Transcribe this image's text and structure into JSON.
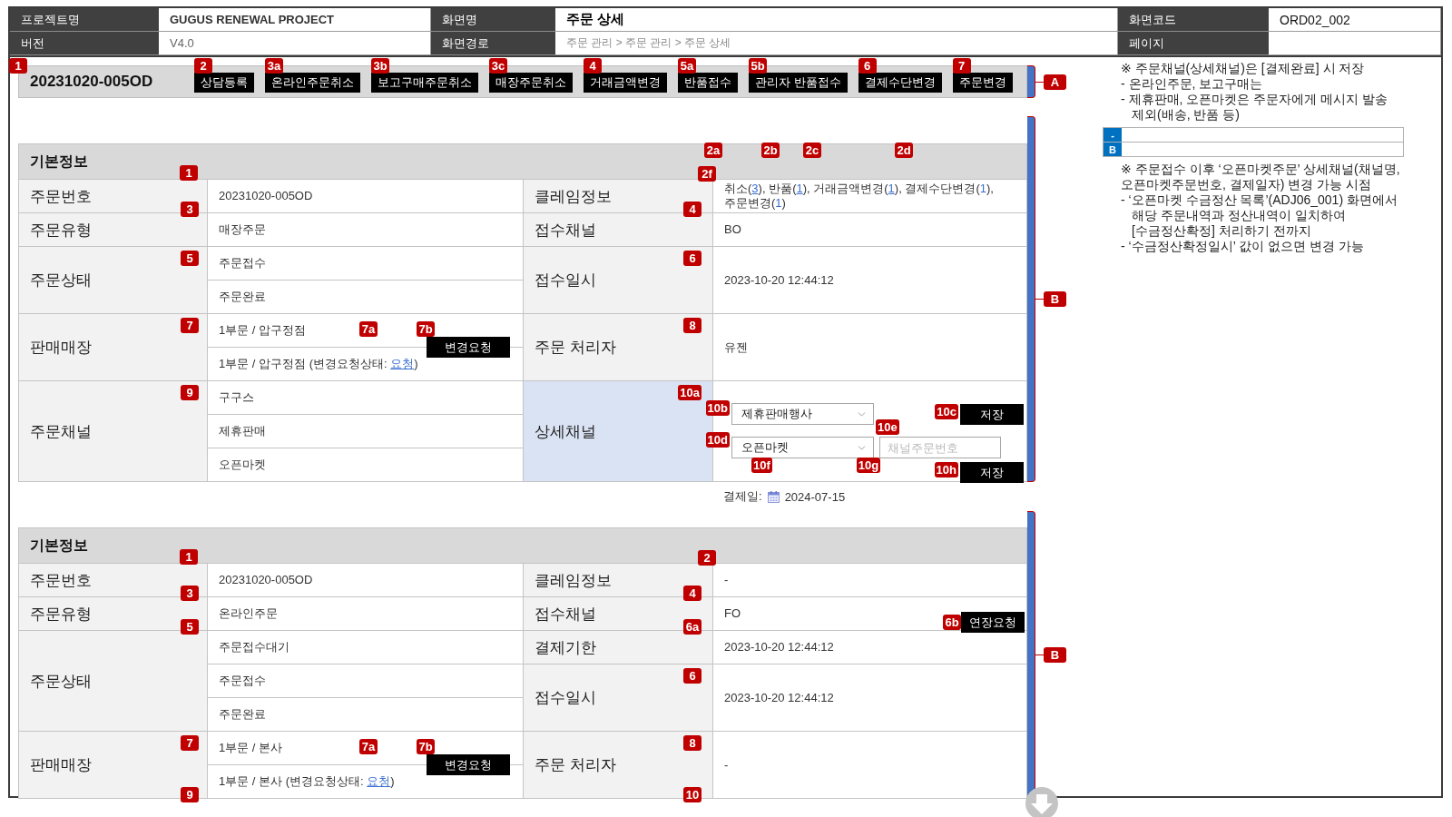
{
  "header": {
    "rows": [
      [
        {
          "label": "프로젝트명",
          "value": "GUGUS RENEWAL PROJECT",
          "kind": "project"
        },
        {
          "label": "화면명",
          "value": "주문 상세",
          "kind": "title"
        },
        {
          "label": "화면코드",
          "value": "ORD02_002",
          "kind": "code"
        }
      ],
      [
        {
          "label": "버전",
          "value": "V4.0",
          "kind": "version"
        },
        {
          "label": "화면경로",
          "value": "주문 관리 > 주문 관리 > 주문 상세",
          "kind": "path"
        },
        {
          "label": "페이지"
        }
      ]
    ]
  },
  "toolbar": {
    "marker": "1",
    "order_number": "20231020-005OD",
    "bracket": "A",
    "buttons": [
      {
        "label": "상담등록",
        "marker": "2"
      },
      {
        "label": "온라인주문취소",
        "marker": "3a"
      },
      {
        "label": "보고구매주문취소",
        "marker": "3b"
      },
      {
        "label": "매장주문취소",
        "marker": "3c"
      },
      {
        "label": "거래금액변경",
        "marker": "4"
      },
      {
        "label": "반품접수",
        "marker": "5a"
      },
      {
        "label": "관리자 반품접수",
        "marker": "5b"
      },
      {
        "label": "결제수단변경",
        "marker": "6"
      },
      {
        "label": "주문변경",
        "marker": "7"
      }
    ]
  },
  "sections": [
    {
      "title": "기본정보",
      "bracket": "B",
      "title_markers": [
        "1"
      ],
      "side_markers": [
        "2a",
        "2b",
        "2c",
        "2d",
        "2f"
      ],
      "rows": [
        {
          "left": {
            "label": "주문번호",
            "markers": [
              "3"
            ],
            "values": [
              {
                "kind": "text",
                "text": "20231020-005OD"
              }
            ]
          },
          "right": [
            {
              "label": "클레임정보",
              "markers": [
                "4"
              ],
              "highlighted": false,
              "value": {
                "kind": "segments",
                "segments": [
                  {
                    "kind": "text",
                    "text": "취소("
                  },
                  {
                    "kind": "link",
                    "text": "3",
                    "underlined": true
                  },
                  {
                    "kind": "text",
                    "text": "), 반품("
                  },
                  {
                    "kind": "link",
                    "text": "1",
                    "underlined": true
                  },
                  {
                    "kind": "text",
                    "text": "), 거래금액변경("
                  },
                  {
                    "kind": "link",
                    "text": "1",
                    "underlined": true
                  },
                  {
                    "kind": "text",
                    "text": "), 결제수단변경("
                  },
                  {
                    "kind": "link",
                    "text": "1",
                    "underlined": false
                  },
                  {
                    "kind": "text",
                    "text": "), 주문변경("
                  },
                  {
                    "kind": "link",
                    "text": "1",
                    "underlined": false
                  },
                  {
                    "kind": "text",
                    "text": ")"
                  }
                ]
              }
            }
          ]
        },
        {
          "left": {
            "label": "주문유형",
            "values": [
              {
                "kind": "text",
                "text": "매장주문"
              }
            ]
          },
          "right": [
            {
              "label": "접수채널",
              "highlighted": false,
              "value": {
                "kind": "text",
                "text": "BO"
              }
            }
          ]
        },
        {
          "left": {
            "label": "주문상태",
            "markers": [
              "5"
            ],
            "values": [
              {
                "kind": "text",
                "text": "주문접수"
              },
              {
                "kind": "text",
                "text": "주문완료"
              }
            ]
          },
          "right": [
            {
              "label": "접수일시",
              "markers": [
                "6"
              ],
              "highlighted": false,
              "value": {
                "kind": "text",
                "text": "2023-10-20 12:44:12"
              }
            }
          ]
        },
        {
          "left": {
            "label": "판매매장",
            "markers": [
              "7"
            ],
            "values": [
              {
                "kind": "text",
                "text": "1부문 / 압구정점",
                "markers": [
                  "7a",
                  "7b"
                ],
                "action": {
                  "label": "변경요청"
                }
              },
              {
                "kind": "segments",
                "segments": [
                  {
                    "kind": "text",
                    "text": "1부문 / 압구정점 (변경요청상태: "
                  },
                  {
                    "kind": "link",
                    "text": "요청",
                    "underlined": true
                  },
                  {
                    "kind": "text",
                    "text": ")"
                  }
                ]
              }
            ]
          },
          "right": [
            {
              "label": "주문 처리자",
              "markers": [
                "8"
              ],
              "highlighted": false,
              "value": {
                "kind": "text",
                "text": "유젠"
              }
            }
          ]
        },
        {
          "left": {
            "label": "주문채널",
            "markers": [
              "9"
            ],
            "values": [
              {
                "kind": "text",
                "text": "구구스"
              },
              {
                "kind": "text",
                "text": "제휴판매"
              },
              {
                "kind": "text",
                "text": "오픈마켓"
              }
            ]
          },
          "right": [
            {
              "label": "상세채널",
              "markers": [
                "10a"
              ],
              "highlighted": true,
              "value": {
                "kind": "channel",
                "rows": [
                  [
                    {
                      "kind": "select",
                      "value": "제휴판매행사",
                      "marker": "10b"
                    },
                    {
                      "kind": "button",
                      "label": "저장",
                      "marker": "10c"
                    }
                  ],
                  [
                    {
                      "kind": "select",
                      "value": "오픈마켓",
                      "marker": "10d"
                    },
                    {
                      "kind": "input",
                      "placeholder": "채널주문번호",
                      "marker": "10e"
                    }
                  ],
                  [
                    {
                      "kind": "marker",
                      "text": "10f"
                    },
                    {
                      "kind": "marker",
                      "text": "10g"
                    },
                    {
                      "kind": "button",
                      "label": "저장",
                      "marker": "10h"
                    }
                  ]
                ]
              }
            }
          ]
        }
      ],
      "footer": {
        "label": "결제일:",
        "value": "2024-07-15"
      }
    },
    {
      "title": "기본정보",
      "bracket": "B",
      "title_markers": [
        "1"
      ],
      "side_markers": [
        "2"
      ],
      "rows": [
        {
          "left": {
            "label": "주문번호",
            "markers": [
              "3"
            ],
            "values": [
              {
                "kind": "text",
                "text": "20231020-005OD"
              }
            ]
          },
          "right": [
            {
              "label": "클레임정보",
              "markers": [
                "4"
              ],
              "highlighted": false,
              "value": {
                "kind": "text",
                "text": "-"
              }
            }
          ]
        },
        {
          "left": {
            "label": "주문유형",
            "markers": [
              "5"
            ],
            "values": [
              {
                "kind": "text",
                "text": "온라인주문"
              }
            ]
          },
          "right": [
            {
              "label": "접수채널",
              "markers": [
                "6a"
              ],
              "highlighted": false,
              "value": {
                "kind": "text",
                "text": "FO",
                "action": {
                  "label": "연장요청",
                  "marker": "6b"
                }
              }
            }
          ]
        },
        {
          "left": {
            "label": "주문상태",
            "values": [
              {
                "kind": "text",
                "text": "주문접수대기"
              },
              {
                "kind": "text",
                "text": "주문접수"
              },
              {
                "kind": "text",
                "text": "주문완료"
              }
            ]
          },
          "right": [
            {
              "label": "결제기한",
              "highlighted": false,
              "value": {
                "kind": "text",
                "text": "2023-10-20 12:44:12"
              }
            },
            {
              "label": "접수일시",
              "markers": [
                "6"
              ],
              "highlighted": false,
              "value": {
                "kind": "text",
                "text": "2023-10-20 12:44:12"
              }
            }
          ]
        },
        {
          "left": {
            "label": "판매매장",
            "markers": [
              "7",
              "9"
            ],
            "values": [
              {
                "kind": "text",
                "text": "1부문 / 본사",
                "markers": [
                  "7a",
                  "7b"
                ],
                "action": {
                  "label": "변경요청"
                }
              },
              {
                "kind": "segments",
                "segments": [
                  {
                    "kind": "text",
                    "text": "1부문 / 본사 (변경요청상태: "
                  },
                  {
                    "kind": "link",
                    "text": "요청",
                    "underlined": true
                  },
                  {
                    "kind": "text",
                    "text": ")"
                  }
                ]
              }
            ]
          },
          "right": [
            {
              "label": "주문 처리자",
              "markers": [
                "8",
                "10"
              ],
              "highlighted": false,
              "value": {
                "kind": "text",
                "text": "-"
              }
            }
          ]
        }
      ]
    }
  ],
  "notes": {
    "blocks": [
      {
        "kind": "note",
        "heading": "※ 주문채널(상세채널)은 [결제완료] 시 저장",
        "items": [
          "- 온라인주문, 보고구매는",
          "- 제휴판매, 오픈마켓은 주문자에게 메시지 발송 제외(배송, 반품 등)"
        ]
      },
      {
        "kind": "revisions",
        "rows": [
          {
            "mark": "-"
          },
          {
            "mark": "B"
          }
        ]
      },
      {
        "kind": "note",
        "heading": "※ 주문접수 이후 ‘오픈마켓주문’ 상세채널(채널명, 오픈마켓주문번호, 결제일자) 변경 가능 시점",
        "items": [
          "- ‘오픈마켓 수금정산 목록’(ADJ06_001) 화면에서 해당 주문내역과 정산내역이 일치하여 [수금정산확정] 처리하기 전까지",
          "- ‘수금정산확정일시’ 값이 없으면 변경 가능"
        ]
      }
    ]
  }
}
